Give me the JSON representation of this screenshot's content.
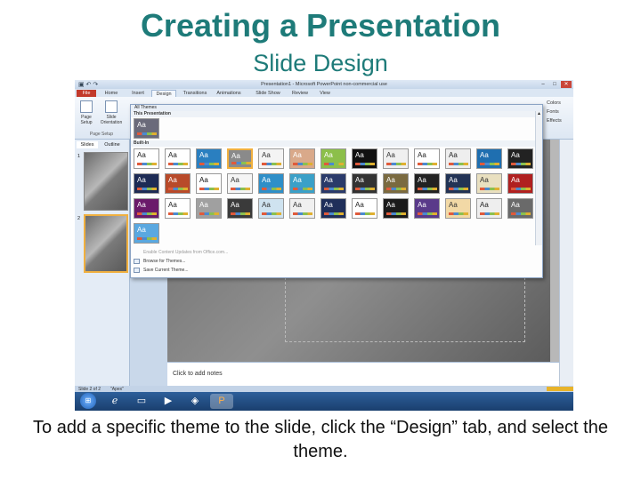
{
  "page": {
    "title": "Creating a Presentation",
    "subtitle": "Slide Design",
    "caption": "To add a specific theme to the slide, click the “Design” tab, and select the theme."
  },
  "window": {
    "title": "Presentation1 - Microsoft PowerPoint non-commercial use",
    "controls": [
      "–",
      "□",
      "✕"
    ]
  },
  "ribbon": {
    "tabs": [
      {
        "label": "File",
        "kind": "file"
      },
      {
        "label": "Home",
        "kind": "normal"
      },
      {
        "label": "Insert",
        "kind": "normal"
      },
      {
        "label": "Design",
        "kind": "active"
      },
      {
        "label": "Transitions",
        "kind": "normal"
      },
      {
        "label": "Animations",
        "kind": "normal"
      },
      {
        "label": "Slide Show",
        "kind": "normal"
      },
      {
        "label": "Review",
        "kind": "normal"
      },
      {
        "label": "View",
        "kind": "normal"
      }
    ],
    "page_setup_label": "Page Setup",
    "slide_orientation_label": "Slide Orientation",
    "group_label": "Page Setup",
    "right_items": [
      "Colors",
      "Fonts",
      "Effects"
    ]
  },
  "left_pane": {
    "tabs": [
      "Slides",
      "Outline"
    ],
    "slide_numbers": [
      "1",
      "2"
    ]
  },
  "gallery": {
    "header": "All Themes",
    "section_this": "This Presentation",
    "section_builtin": "Built-In",
    "menu": [
      {
        "label": "Enable Content Updates from Office.com...",
        "disabled": true
      },
      {
        "label": "Browse for Themes...",
        "disabled": false
      },
      {
        "label": "Save Current Theme...",
        "disabled": false
      }
    ],
    "tile_label": "Aa"
  },
  "notes_placeholder": "Click to add notes",
  "status": {
    "slide_info": "Slide 2 of 2",
    "theme_name": "\"Apex\""
  },
  "colors": {
    "title": "#1e7b79",
    "file_tab": "#c23a2b",
    "selection": "#f0b040"
  }
}
